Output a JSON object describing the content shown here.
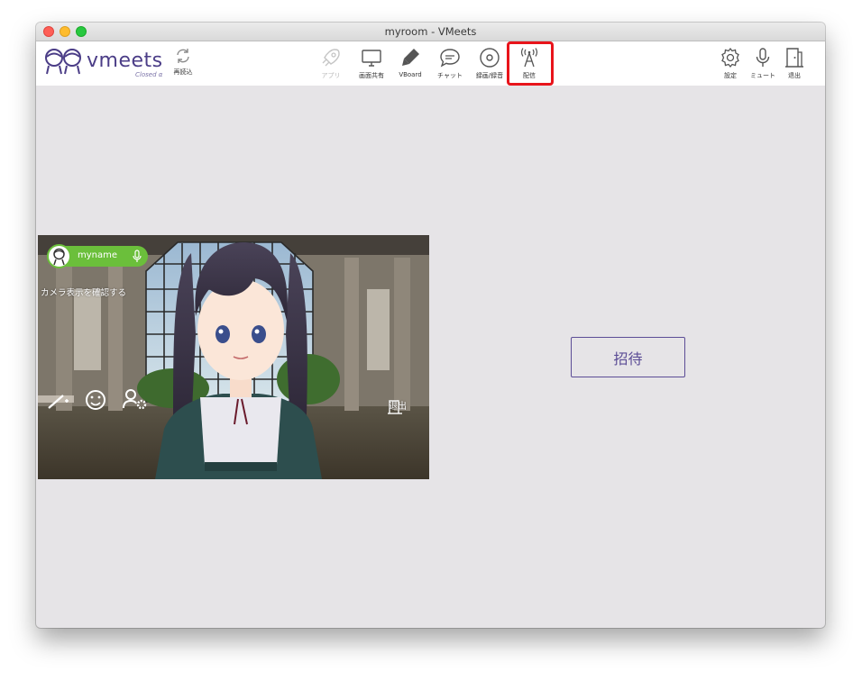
{
  "window": {
    "title": "myroom - VMeets"
  },
  "logo": {
    "text": "vmeets",
    "sub": "Closed α"
  },
  "toolbar": {
    "reload_label": "再読込",
    "app_label": "アプリ",
    "screen_share_label": "画面共有",
    "vboard_label": "VBoard",
    "chat_label": "チャット",
    "record_label": "録画/録音",
    "broadcast_label": "配信",
    "settings_label": "設定",
    "mute_label": "ミュート",
    "exit_label": "退出"
  },
  "video": {
    "name": "myname",
    "camera_check": "カメラ表示を確認する",
    "exit_label": "退出"
  },
  "main": {
    "invite_label": "招待"
  },
  "colors": {
    "brand": "#4b3d87",
    "accent_green": "#6bbf3b",
    "highlight_red": "#e8141b",
    "background": "#e6e4e7"
  }
}
